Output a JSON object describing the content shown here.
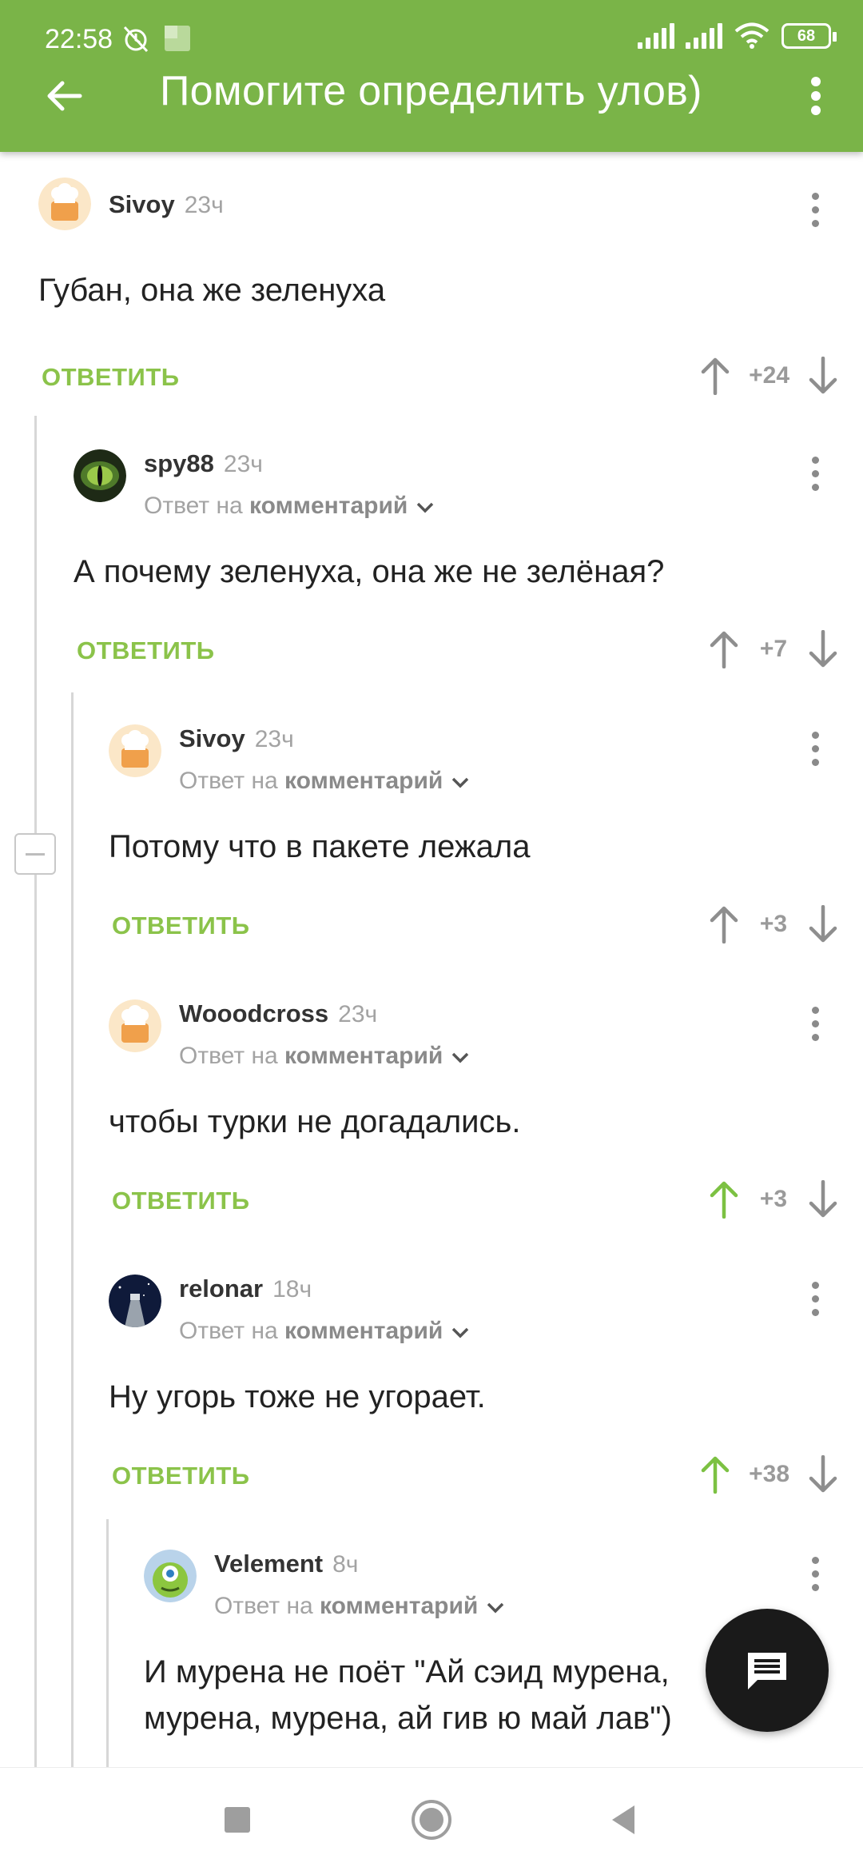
{
  "status_bar": {
    "time": "22:58",
    "battery": "68",
    "icons": [
      "alarm-off-icon",
      "notification-icon",
      "signal-icon",
      "signal-icon",
      "wifi-icon",
      "battery-icon"
    ]
  },
  "app_bar": {
    "title": "Помогите определить улов)",
    "back_icon": "arrow-left-icon",
    "menu_icon": "more-vert-icon",
    "background": "#7ab448"
  },
  "strings": {
    "reply": "ОТВЕТИТЬ",
    "reply_to_prefix": "Ответ на",
    "reply_to_target": "комментарий"
  },
  "comments": [
    {
      "author": "Sivoy",
      "time": "23ч",
      "text": "Губан, она же зеленуха",
      "score": "+24",
      "upvoted": false,
      "is_reply": false,
      "avatar": "default-chef-avatar"
    },
    {
      "author": "spy88",
      "time": "23ч",
      "text": "А почему зеленуха, она же не зелёная?",
      "score": "+7",
      "upvoted": false,
      "is_reply": true,
      "avatar": "eye-avatar"
    },
    {
      "author": "Sivoy",
      "time": "23ч",
      "text": "Потому что в пакете лежала",
      "score": "+3",
      "upvoted": false,
      "is_reply": true,
      "avatar": "default-chef-avatar"
    },
    {
      "author": "Wooodcross",
      "time": "23ч",
      "text": "чтобы турки не догадались.",
      "score": "+3",
      "upvoted": true,
      "is_reply": true,
      "avatar": "default-chef-avatar"
    },
    {
      "author": "relonar",
      "time": "18ч",
      "text": "Ну угорь тоже не угорает.",
      "score": "+38",
      "upvoted": true,
      "is_reply": true,
      "avatar": "space-avatar"
    },
    {
      "author": "Velement",
      "time": "8ч",
      "text_lines": [
        "И мурена не поёт \"Ай сэид мурена,",
        "мурена, мурена, ай гив ю май лав\")"
      ],
      "is_reply": true,
      "avatar": "monster-avatar"
    }
  ],
  "fab": {
    "icon": "comment-icon"
  },
  "nav_bar": {
    "icons": [
      "recents-square-icon",
      "home-circle-icon",
      "back-triangle-icon"
    ]
  },
  "colors": {
    "accent": "#8bc34a",
    "upvote_active": "#7cc142",
    "vote_inactive": "#8e8e8e"
  }
}
